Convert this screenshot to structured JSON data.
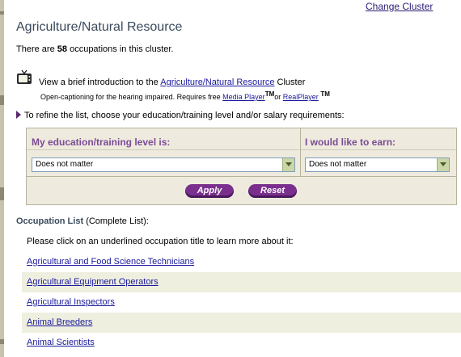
{
  "header": {
    "change_cluster": "Change Cluster",
    "cluster_title": "Agriculture/Natural Resource"
  },
  "count": {
    "prefix": "There are",
    "number": "58",
    "suffix": "occupations in this cluster."
  },
  "intro": {
    "prefix": "View a brief introduction to the",
    "link": "Agriculture/Natural Resource",
    "suffix": "Cluster",
    "caption_prefix": "Open-captioning for the hearing impaired. Requires free",
    "media_player": "Media Player",
    "tm": "TM",
    "or": "or",
    "real_player": "RealPlayer",
    "icon": "tv-icon"
  },
  "refine": {
    "text": "To refine the list, choose your education/training level and/or salary requirements:"
  },
  "filters": {
    "education_label": "My education/training level is:",
    "education_value": "Does not matter",
    "earn_label": "I would like to earn:",
    "earn_value": "Does not matter",
    "apply": "Apply",
    "reset": "Reset"
  },
  "occupations": {
    "heading": "Occupation List",
    "heading_suffix": "(Complete List):",
    "instruction": "Please click on an underlined occupation title to learn more about it:",
    "items": [
      "Agricultural and Food Science Technicians",
      "Agricultural Equipment Operators",
      "Agricultural Inspectors",
      "Animal Breeders",
      "Animal Scientists"
    ]
  },
  "colors": {
    "accent_purple": "#7a2f8f",
    "link_blue": "#1a1a9c",
    "panel_bg": "#eeeade",
    "row_alt": "#efefdf"
  }
}
